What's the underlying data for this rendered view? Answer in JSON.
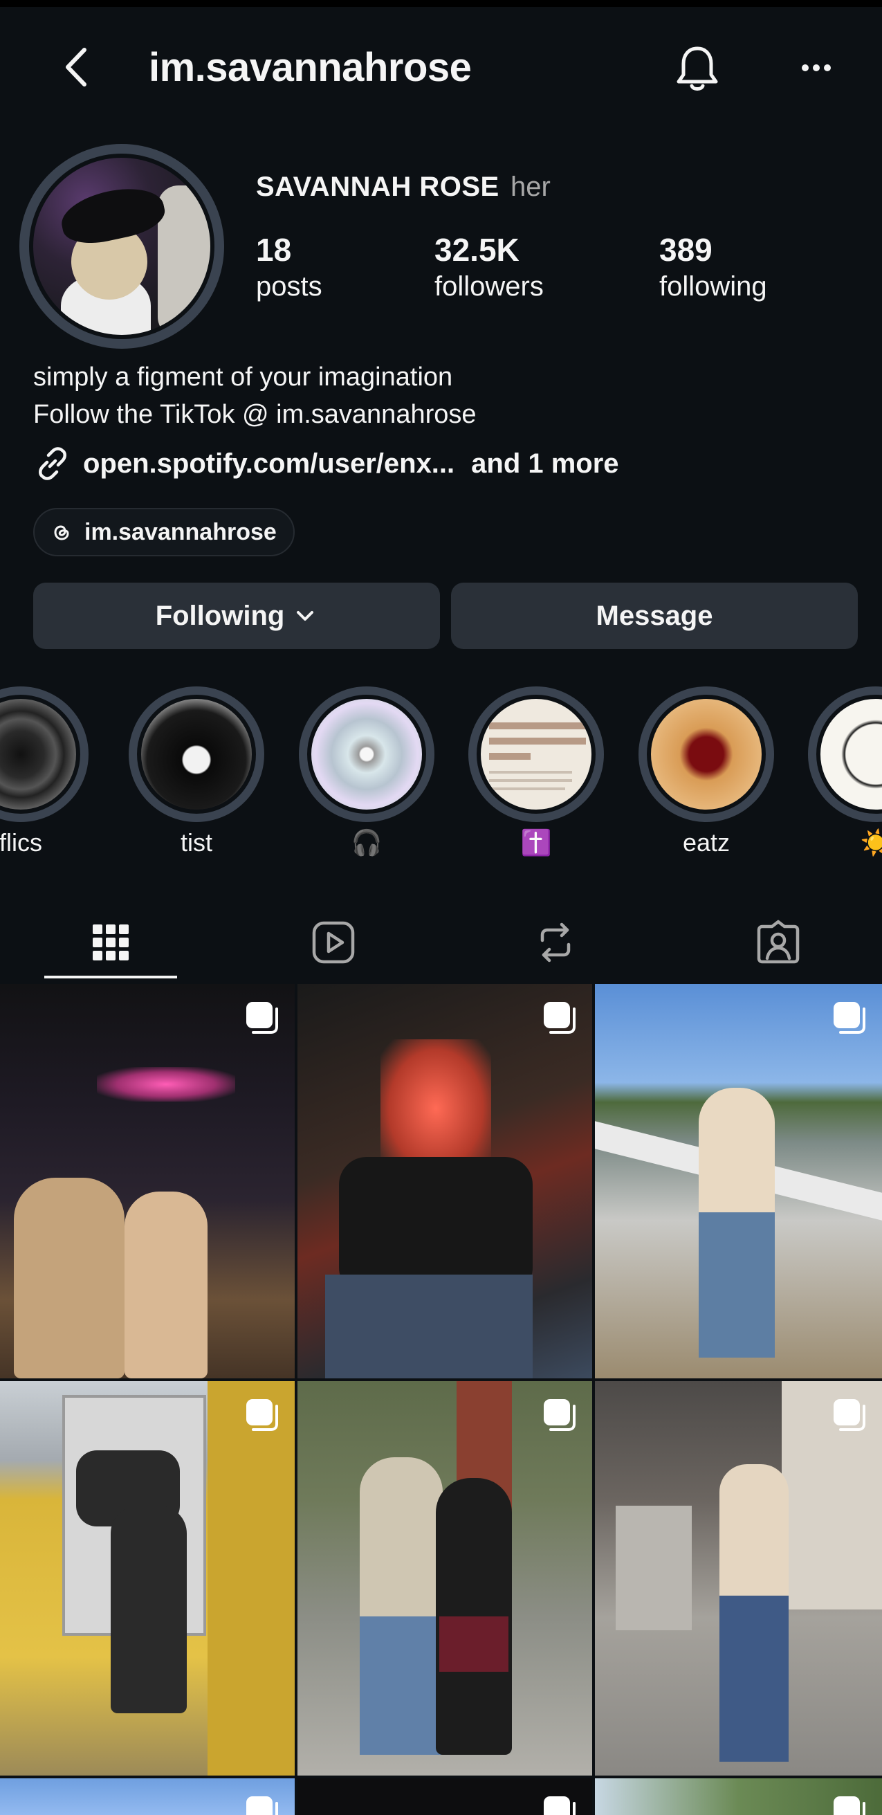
{
  "header": {
    "username": "im.savannahrose",
    "back_icon": "chevron-left-icon",
    "bell_icon": "bell-icon",
    "more_icon": "more-horizontal-icon"
  },
  "profile": {
    "display_name": "SAVANNAH ROSE",
    "pronouns": "her",
    "stats": {
      "posts": {
        "value": "18",
        "label": "posts"
      },
      "followers": {
        "value": "32.5K",
        "label": "followers"
      },
      "following": {
        "value": "389",
        "label": "following"
      }
    },
    "bio_line1": "simply a figment of your imagination",
    "bio_line2": "Follow the TikTok @ im.savannahrose",
    "link_text": "open.spotify.com/user/enx...",
    "link_more": "and 1 more",
    "threads_handle": "im.savannahrose"
  },
  "actions": {
    "following_label": "Following",
    "message_label": "Message"
  },
  "highlights": [
    {
      "label": "flics"
    },
    {
      "label": "tist"
    },
    {
      "label": "🎧"
    },
    {
      "label": "✝️"
    },
    {
      "label": "eatz"
    },
    {
      "label": "☀️"
    }
  ],
  "tabs": [
    {
      "name": "grid",
      "icon": "grid-icon",
      "active": true
    },
    {
      "name": "reels",
      "icon": "reels-icon",
      "active": false
    },
    {
      "name": "reposts",
      "icon": "repost-icon",
      "active": false
    },
    {
      "name": "tagged",
      "icon": "tagged-icon",
      "active": false
    }
  ],
  "colors": {
    "background": "#0c1014",
    "button": "#2a3038",
    "secondary_text": "#a8a8a8"
  }
}
